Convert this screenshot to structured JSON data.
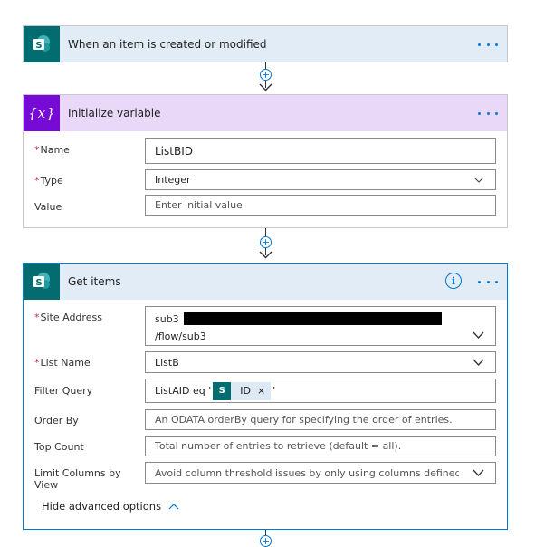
{
  "trigger": {
    "title": "When an item is created or modified",
    "icon": "sharepoint-icon"
  },
  "init_variable": {
    "title": "Initialize variable",
    "icon": "variable-icon",
    "header_color": "#e9d8f7",
    "icon_bg": "#770bd6",
    "fields": {
      "name_label": "Name",
      "name_value": "ListBID",
      "type_label": "Type",
      "type_value": "Integer",
      "value_label": "Value",
      "value_placeholder": "Enter initial value"
    }
  },
  "get_items": {
    "title": "Get items",
    "icon": "sharepoint-icon",
    "header_color": "#e1ecf6",
    "fields": {
      "site_label": "Site Address",
      "site_value_line1": "sub3",
      "site_value_line2": "/flow/sub3",
      "list_label": "List Name",
      "list_value": "ListB",
      "filter_label": "Filter Query",
      "filter_prefix": "ListAID eq '",
      "filter_token": "ID",
      "filter_suffix": "'",
      "order_label": "Order By",
      "order_placeholder": "An ODATA orderBy query for specifying the order of entries.",
      "top_label": "Top Count",
      "top_placeholder": "Total number of entries to retrieve (default = all).",
      "limit_label": "Limit Columns by View",
      "limit_placeholder": "Avoid column threshold issues by only using columns defined in a"
    },
    "advanced_toggle": "Hide advanced options"
  },
  "required_marker": "*",
  "accent_color": "#0078d4",
  "sharepoint_color": "#036c70"
}
